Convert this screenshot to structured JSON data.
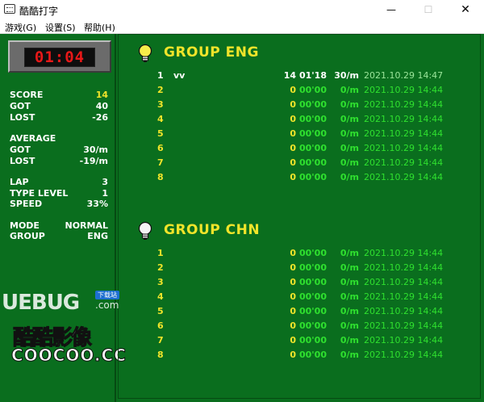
{
  "window": {
    "title": "酷酷打字",
    "min": "—",
    "max": "☐",
    "close": "✕"
  },
  "menu": [
    "游戏(G)",
    "设置(S)",
    "帮助(H)"
  ],
  "timer": "01:04",
  "stats": {
    "score_label": "SCORE",
    "score": "14",
    "got_label": "GOT",
    "got": "40",
    "lost_label": "LOST",
    "lost": "-26",
    "average_label": "AVERAGE",
    "avg_got_label": "GOT",
    "avg_got": "30/m",
    "avg_lost_label": "LOST",
    "avg_lost": "-19/m",
    "lap_label": "LAP",
    "lap": "3",
    "type_level_label": "TYPE LEVEL",
    "type_level": "1",
    "speed_label": "SPEED",
    "speed": "33%",
    "mode_label": "MODE",
    "mode": "NORMAL",
    "group_label": "GROUP",
    "group": "ENG"
  },
  "logo": {
    "cn": "酷酷影像",
    "en": "COOCOO.CC"
  },
  "watermark": {
    "text": "UEBUG",
    "com": ".com",
    "tag": "下载站"
  },
  "groups": [
    {
      "title": "GROUP ENG",
      "rows": [
        {
          "idx": "1",
          "name": "vv",
          "score": "14",
          "time": "01'18",
          "speed": "30/m",
          "date": "2021.10.29 14:47"
        },
        {
          "idx": "2",
          "name": "",
          "score": "0",
          "time": "00'00",
          "speed": "0/m",
          "date": "2021.10.29 14:44"
        },
        {
          "idx": "3",
          "name": "",
          "score": "0",
          "time": "00'00",
          "speed": "0/m",
          "date": "2021.10.29 14:44"
        },
        {
          "idx": "4",
          "name": "",
          "score": "0",
          "time": "00'00",
          "speed": "0/m",
          "date": "2021.10.29 14:44"
        },
        {
          "idx": "5",
          "name": "",
          "score": "0",
          "time": "00'00",
          "speed": "0/m",
          "date": "2021.10.29 14:44"
        },
        {
          "idx": "6",
          "name": "",
          "score": "0",
          "time": "00'00",
          "speed": "0/m",
          "date": "2021.10.29 14:44"
        },
        {
          "idx": "7",
          "name": "",
          "score": "0",
          "time": "00'00",
          "speed": "0/m",
          "date": "2021.10.29 14:44"
        },
        {
          "idx": "8",
          "name": "",
          "score": "0",
          "time": "00'00",
          "speed": "0/m",
          "date": "2021.10.29 14:44"
        }
      ]
    },
    {
      "title": "GROUP CHN",
      "rows": [
        {
          "idx": "1",
          "name": "",
          "score": "0",
          "time": "00'00",
          "speed": "0/m",
          "date": "2021.10.29 14:44"
        },
        {
          "idx": "2",
          "name": "",
          "score": "0",
          "time": "00'00",
          "speed": "0/m",
          "date": "2021.10.29 14:44"
        },
        {
          "idx": "3",
          "name": "",
          "score": "0",
          "time": "00'00",
          "speed": "0/m",
          "date": "2021.10.29 14:44"
        },
        {
          "idx": "4",
          "name": "",
          "score": "0",
          "time": "00'00",
          "speed": "0/m",
          "date": "2021.10.29 14:44"
        },
        {
          "idx": "5",
          "name": "",
          "score": "0",
          "time": "00'00",
          "speed": "0/m",
          "date": "2021.10.29 14:44"
        },
        {
          "idx": "6",
          "name": "",
          "score": "0",
          "time": "00'00",
          "speed": "0/m",
          "date": "2021.10.29 14:44"
        },
        {
          "idx": "7",
          "name": "",
          "score": "0",
          "time": "00'00",
          "speed": "0/m",
          "date": "2021.10.29 14:44"
        },
        {
          "idx": "8",
          "name": "",
          "score": "0",
          "time": "00'00",
          "speed": "0/m",
          "date": "2021.10.29 14:44"
        }
      ]
    }
  ]
}
